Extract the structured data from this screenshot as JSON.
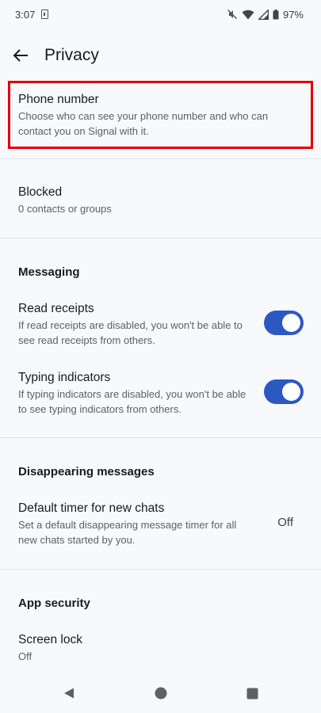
{
  "status_bar": {
    "time": "3:07",
    "battery": "97%",
    "icons": [
      "sim-icon",
      "mute-icon",
      "wifi-icon",
      "signal-icon",
      "battery-icon"
    ]
  },
  "app_bar": {
    "back_icon": "arrow-left-icon",
    "title": "Privacy"
  },
  "phone_number": {
    "title": "Phone number",
    "summary": "Choose who can see your phone number and who can contact you on Signal with it.",
    "highlight_color": "#e30000"
  },
  "blocked": {
    "title": "Blocked",
    "summary": "0 contacts or groups"
  },
  "messaging": {
    "header": "Messaging",
    "read_receipts": {
      "title": "Read receipts",
      "summary": "If read receipts are disabled, you won't be able to see read receipts from others.",
      "enabled": true
    },
    "typing_indicators": {
      "title": "Typing indicators",
      "summary": "If typing indicators are disabled, you won't be able to see typing indicators from others.",
      "enabled": true
    }
  },
  "disappearing": {
    "header": "Disappearing messages",
    "default_timer": {
      "title": "Default timer for new chats",
      "summary": "Set a default disappearing message timer for all new chats started by you.",
      "value": "Off"
    }
  },
  "app_security": {
    "header": "App security",
    "screen_lock": {
      "title": "Screen lock",
      "summary": "Off"
    }
  },
  "colors": {
    "accent": "#2c58c1",
    "background": "#f8f9fd"
  },
  "nav_bar": {
    "icons": [
      "back-triangle-icon",
      "home-circle-icon",
      "recents-square-icon"
    ]
  }
}
